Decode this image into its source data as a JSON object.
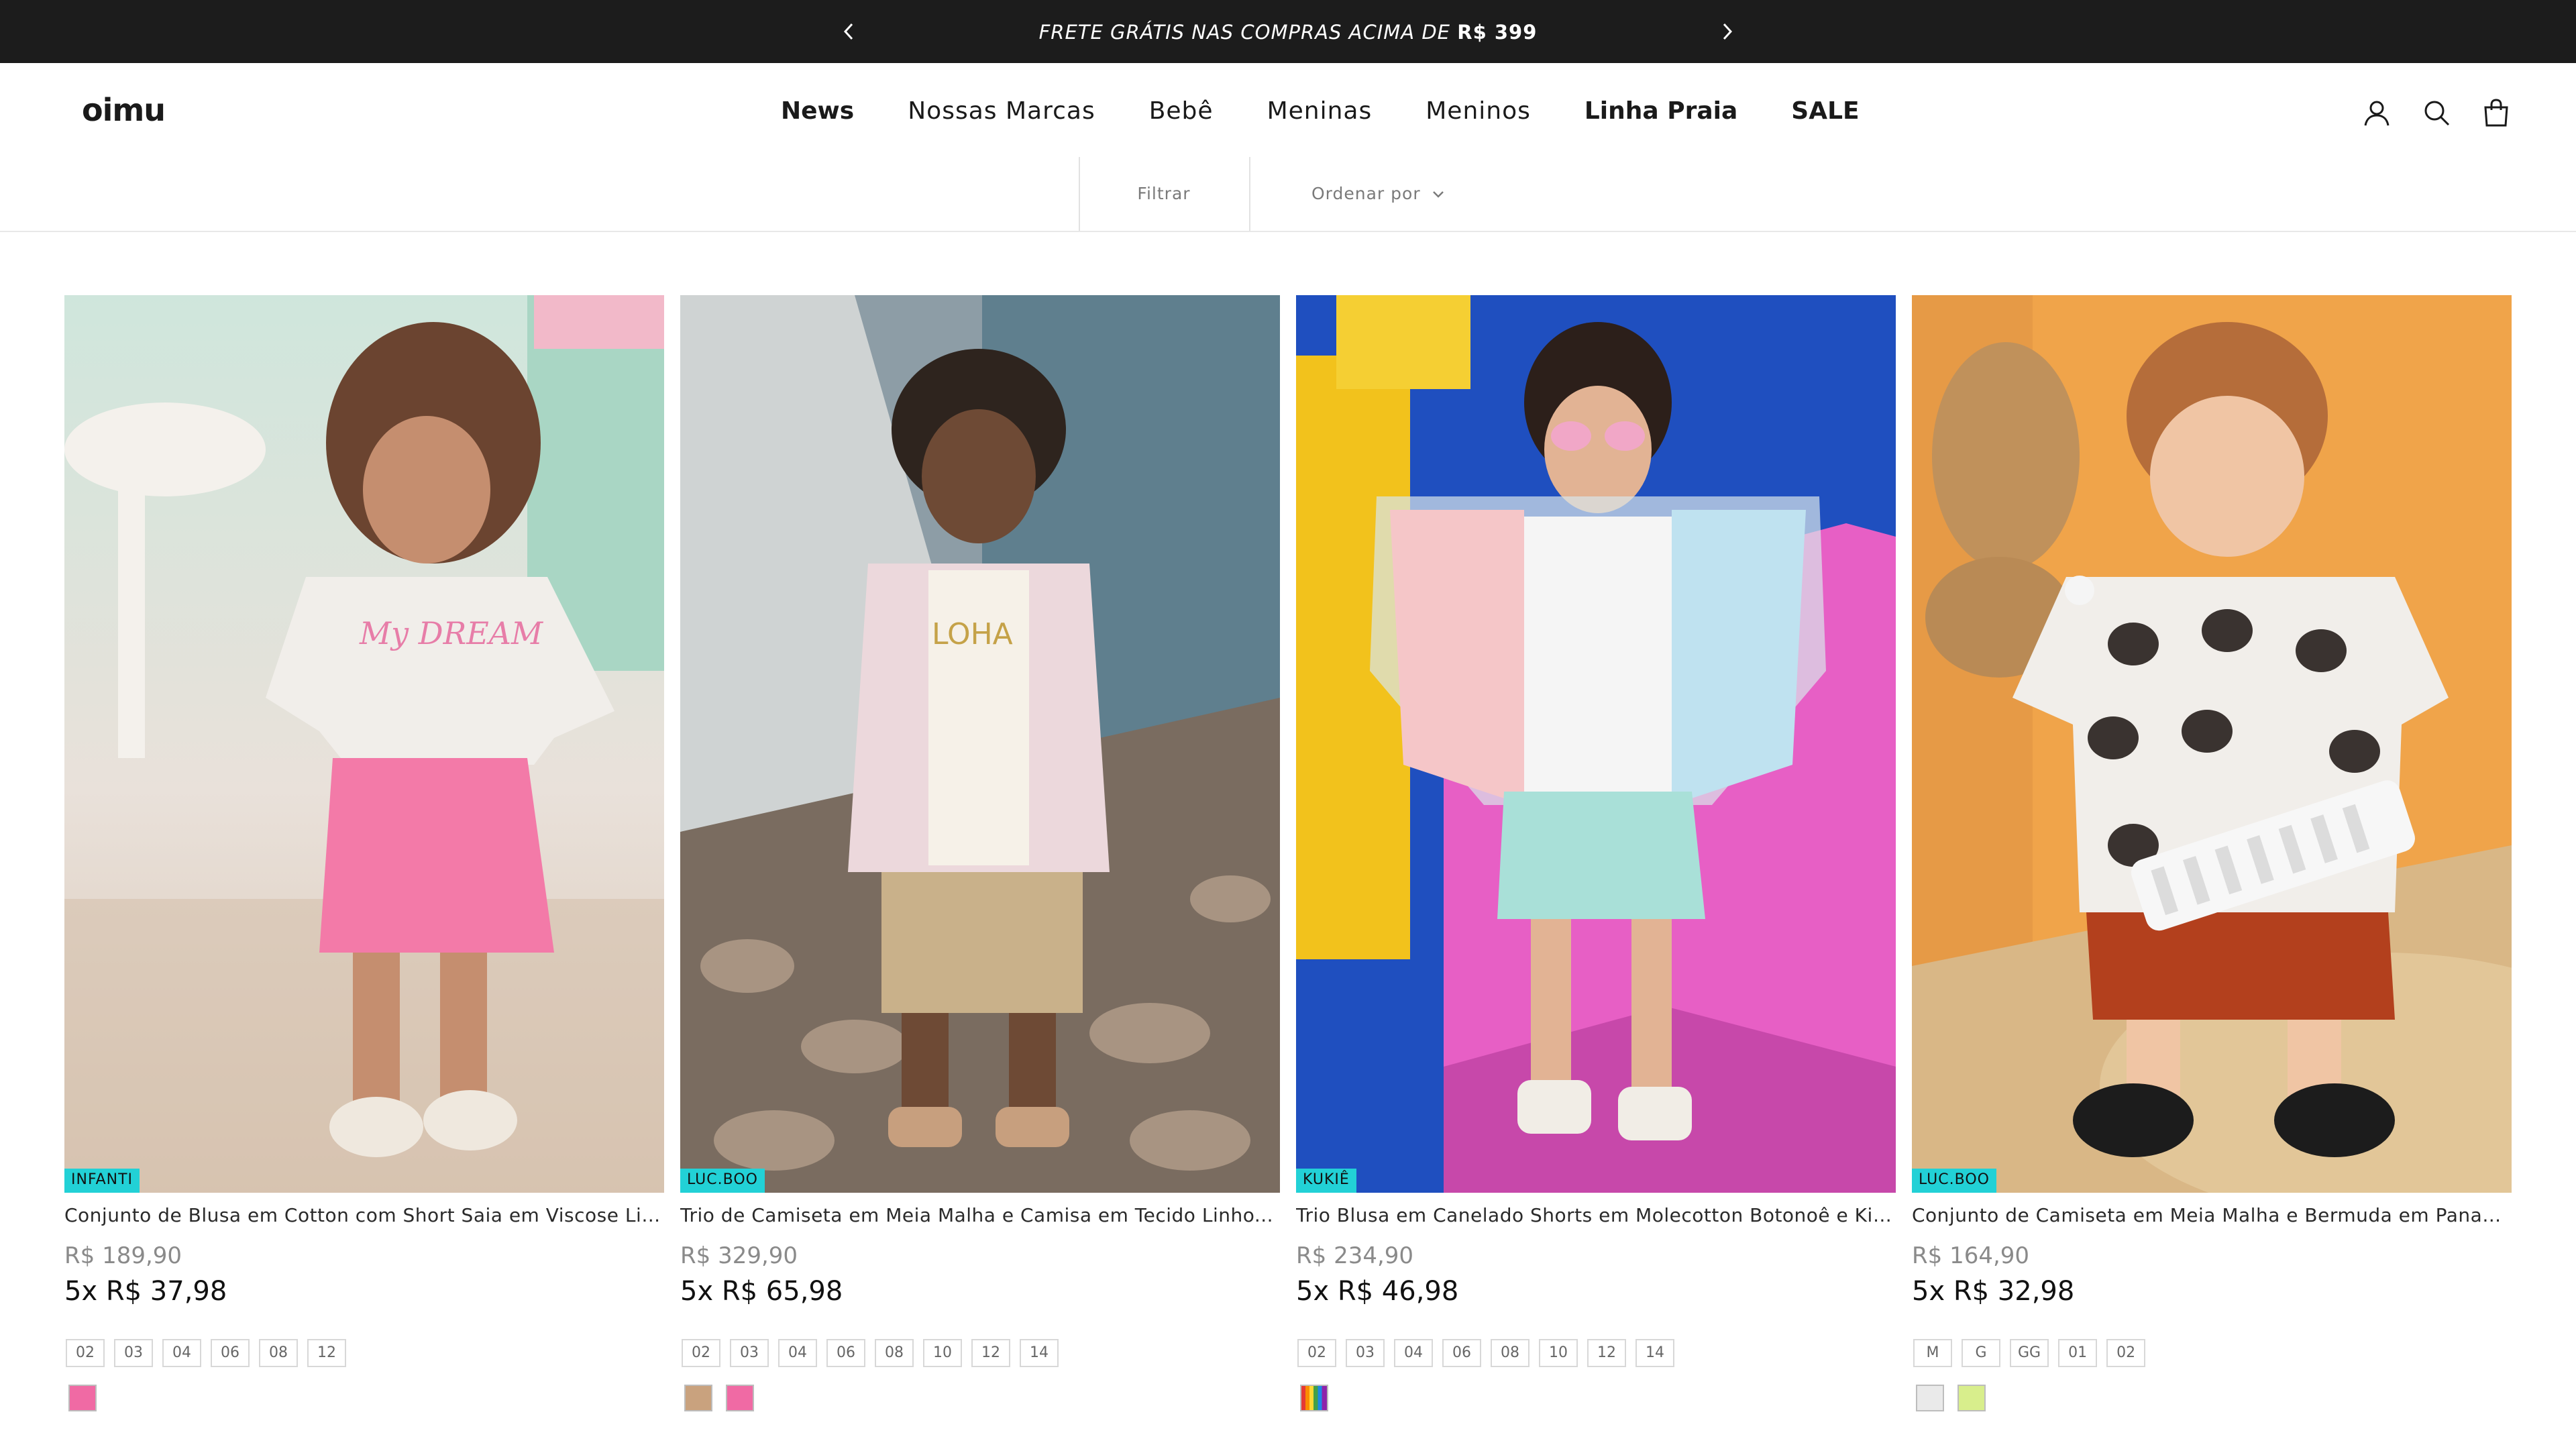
{
  "announcement": {
    "text": "FRETE GRÁTIS NAS COMPRAS ACIMA DE",
    "amount": "R$ 399",
    "prev_icon": "chevron-left-icon",
    "next_icon": "chevron-right-icon"
  },
  "header": {
    "logo": "oimu",
    "nav": [
      {
        "label": "News"
      },
      {
        "label": "Nossas Marcas"
      },
      {
        "label": "Bebê"
      },
      {
        "label": "Meninas"
      },
      {
        "label": "Meninos"
      },
      {
        "label": "Linha Praia"
      },
      {
        "label": "SALE"
      }
    ],
    "icons": [
      "account-icon",
      "search-icon",
      "cart-icon"
    ]
  },
  "filters": {
    "filter_label": "Filtrar",
    "sort_label": "Ordenar por"
  },
  "products": [
    {
      "brand": "INFANTI",
      "title": "Conjunto de Blusa em Cotton com Short Saia em Viscose Linho...",
      "price": "R$ 189,90",
      "installments": "5x R$ 37,98",
      "sizes": [
        "02",
        "03",
        "04",
        "06",
        "08",
        "12"
      ],
      "swatches": [
        "#f06aa4"
      ]
    },
    {
      "brand": "LUC.BOO",
      "title": "Trio de Camiseta em Meia Malha e Camisa em Tecido Linho...",
      "price": "R$ 329,90",
      "installments": "5x R$ 65,98",
      "sizes": [
        "02",
        "03",
        "04",
        "06",
        "08",
        "10",
        "12",
        "14"
      ],
      "swatches": [
        "#c9a27e",
        "#f06aa4"
      ]
    },
    {
      "brand": "KUKIÊ",
      "title": "Trio Blusa em Canelado Shorts em Molecotton Botonoê e Kimon...",
      "price": "R$ 234,90",
      "installments": "5x R$ 46,98",
      "sizes": [
        "02",
        "03",
        "04",
        "06",
        "08",
        "10",
        "12",
        "14"
      ],
      "swatches": [
        "multicolor"
      ]
    },
    {
      "brand": "LUC.BOO",
      "title": "Conjunto de Camiseta em Meia Malha e Bermuda em Panamá...",
      "price": "R$ 164,90",
      "installments": "5x R$ 32,98",
      "sizes": [
        "M",
        "G",
        "GG",
        "01",
        "02"
      ],
      "swatches": [
        "#eaeaea",
        "#d8ee8c"
      ]
    }
  ]
}
